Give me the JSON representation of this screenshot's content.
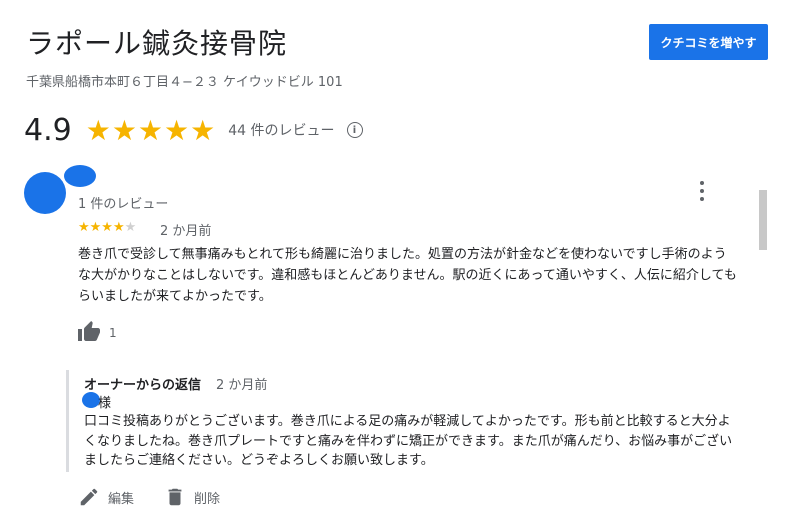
{
  "business": {
    "name": "ラポール鍼灸接骨院",
    "address": "千葉県船橋市本町６丁目４−２３ ケイウッドビル 101",
    "rating": "4.9",
    "stars": "★★★★★",
    "review_count": "44 件のレビュー",
    "info_icon": "info-icon"
  },
  "cta_button": "クチコミを増やす",
  "review": {
    "reviewer_meta": "1 件のレビュー",
    "stars_filled": "★★★★",
    "stars_empty": "★",
    "rating_value": 4,
    "date": "2 か月前",
    "text": "巻き爪で受診して無事痛みもとれて形も綺麗に治りました。処置の方法が針金などを使わないですし手術のような大がかりなことはしないです。違和感もほとんどありません。駅の近くにあって通いやすく、人伝に紹介してもらいましたが来てよかったです。",
    "like_count": "1"
  },
  "reply": {
    "label": "オーナーからの返信",
    "date": "2 か月前",
    "honorific": "様",
    "text": "口コミ投稿ありがとうございます。巻き爪による足の痛みが軽減してよかったです。形も前と比較すると大分よくなりましたね。巻き爪プレートですと痛みを伴わずに矯正ができます。また爪が痛んだり、お悩み事がございましたらご連絡ください。どうぞよろしくお願い致します。"
  },
  "actions": {
    "edit": "編集",
    "delete": "削除"
  },
  "colors": {
    "accent": "#1a73e8",
    "star": "#f6b400"
  }
}
